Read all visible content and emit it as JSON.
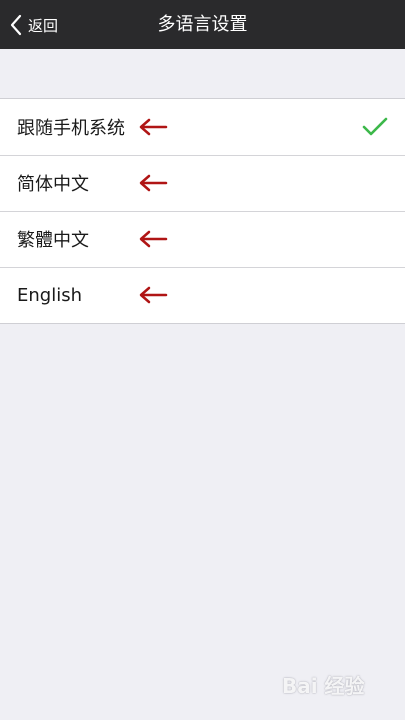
{
  "navbar": {
    "back_label": "返回",
    "title": "多语言设置"
  },
  "languages": {
    "items": [
      {
        "label": "跟随手机系统",
        "selected": true
      },
      {
        "label": "简体中文",
        "selected": false
      },
      {
        "label": "繁體中文",
        "selected": false
      },
      {
        "label": "English",
        "selected": false
      }
    ]
  },
  "watermark": {
    "text": "Bai 经验"
  },
  "colors": {
    "navbar_bg": "#2a2a2c",
    "page_bg": "#efeff4",
    "check": "#3cb84a",
    "annotation_arrow": "#b01515"
  },
  "icons": {
    "back": "chevron-left-icon",
    "selected": "checkmark-icon",
    "annotation": "arrow-left-icon"
  }
}
